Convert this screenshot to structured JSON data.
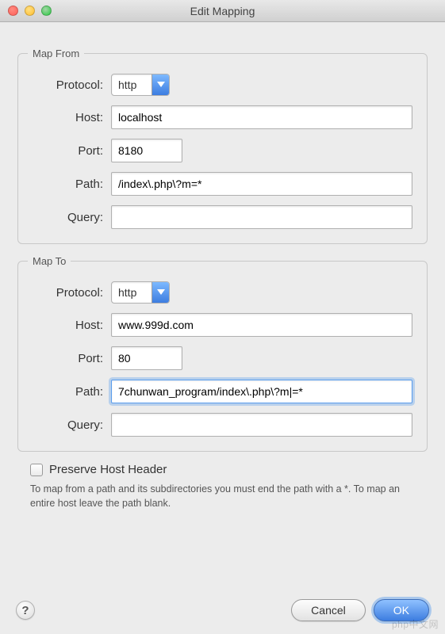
{
  "window": {
    "title": "Edit Mapping"
  },
  "map_from": {
    "legend": "Map From",
    "labels": {
      "protocol": "Protocol:",
      "host": "Host:",
      "port": "Port:",
      "path": "Path:",
      "query": "Query:"
    },
    "protocol": "http",
    "host": "localhost",
    "port": "8180",
    "path": "/index\\.php\\?m=*",
    "query": ""
  },
  "map_to": {
    "legend": "Map To",
    "labels": {
      "protocol": "Protocol:",
      "host": "Host:",
      "port": "Port:",
      "path": "Path:",
      "query": "Query:"
    },
    "protocol": "http",
    "host": "www.999d.com",
    "port": "80",
    "path": "7chunwan_program/index\\.php\\?m|=*",
    "query": ""
  },
  "preserve_host": {
    "label": "Preserve Host Header",
    "checked": false
  },
  "help_text": "To map from a path and its subdirectories you must end the path with a *. To map an entire host leave the path blank.",
  "buttons": {
    "help": "?",
    "cancel": "Cancel",
    "ok": "OK"
  },
  "watermark": "php中文网"
}
